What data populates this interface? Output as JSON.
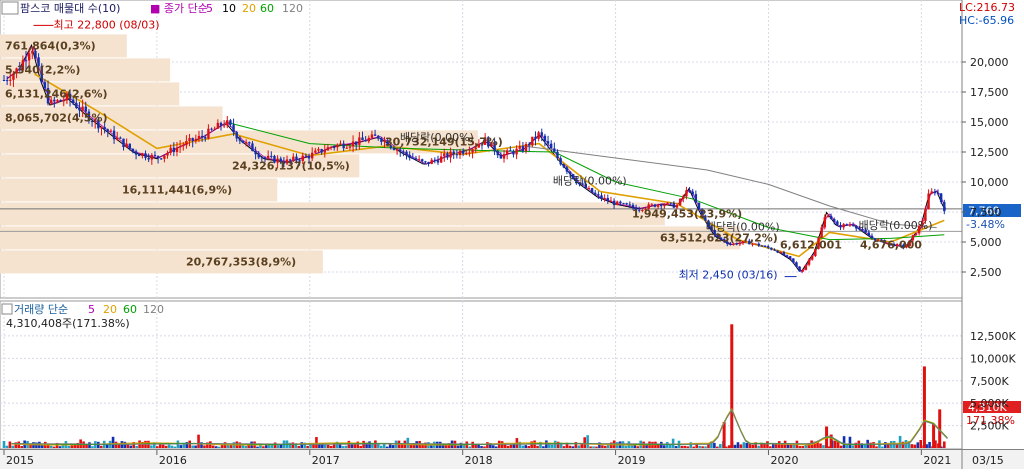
{
  "price_panel": {
    "title": "팜스코 매물대 수(10)",
    "ma_label": "종가 단순",
    "ma_periods": [
      "5",
      "10",
      "20",
      "60",
      "120"
    ],
    "ma_colors": [
      "#b000b0",
      "#000000",
      "#e0a000",
      "#00a000",
      "#808080"
    ],
    "high_marker": "최고 22,800 (08/03)",
    "low_marker": "최저 2,450 (03/16)",
    "lc": "LC:216.73",
    "hc": "HC:-65.96",
    "current_price": "7,760",
    "current_change": "-3.48%",
    "dividend_label": "배당락(0.00%)",
    "y_ticks": [
      "20,000",
      "17,500",
      "15,000",
      "12,500",
      "10,000",
      "7,500",
      "5,000",
      "2,500"
    ]
  },
  "volume_panel": {
    "title": "거래량 단순",
    "ma_periods": [
      "5",
      "20",
      "60",
      "120"
    ],
    "ma_colors": [
      "#b000b0",
      "#e0a000",
      "#00a000",
      "#808080"
    ],
    "summary": "4,310,408주(171.38%)",
    "current_volume": "4,310K",
    "current_ratio": "171.38%",
    "y_ticks": [
      "12,500K",
      "10,000K",
      "7,500K",
      "5,000K",
      "2,500K"
    ]
  },
  "x_axis": {
    "labels": [
      "2015",
      "2016",
      "2017",
      "2018",
      "2019",
      "2020",
      "2021"
    ],
    "last_date": "03/15"
  },
  "chart_data": {
    "type": "candlestick",
    "x_range": [
      "2015-01",
      "2021-03"
    ],
    "price_ylim": [
      1000,
      23500
    ],
    "volume_ylim": [
      0,
      14500
    ],
    "volume_series_unit": "K",
    "volume_profile": [
      {
        "label": "761,864(0,3%)",
        "price": 21300,
        "value": 761864,
        "pct": 0.3
      },
      {
        "label": "5,340(2,2%)",
        "price": 19300,
        "value": 5340,
        "pct": 2.2
      },
      {
        "label": "6,131,246(2,6%)",
        "price": 17300,
        "value": 6131246,
        "pct": 2.6
      },
      {
        "label": "8,065,702(4,5%)",
        "price": 15300,
        "value": 8065702,
        "pct": 4.5
      },
      {
        "label": "30,732,149(15,7%)",
        "price": 13300,
        "value": 30732149,
        "pct": 15.7
      },
      {
        "label": "24,326,137(10,5%)",
        "price": 11300,
        "value": 24326137,
        "pct": 10.5
      },
      {
        "label": "16,111,441(6,9%)",
        "price": 9300,
        "value": 16111441,
        "pct": 6.9
      },
      {
        "label": "1,949,453(23,9%)",
        "price": 7300,
        "value": 1949453,
        "pct": 23.9
      },
      {
        "label": "63,512,623(27,2%)",
        "price": 5300,
        "value": 63512623,
        "pct": 27.2
      },
      {
        "label": "20,767,353(8,9%)",
        "price": 3300,
        "value": 20767353,
        "pct": 8.9
      }
    ],
    "extra_profile_labels": [
      "6,612,001",
      "4,676,000"
    ],
    "high": {
      "date": "2015-08-03",
      "value": 22800
    },
    "low": {
      "date": "2020-03-16",
      "value": 2450
    },
    "last_close": 7760,
    "last_volume_k": 4310,
    "dividend_markers": [
      {
        "date": "2017-12",
        "pct": "0.00%"
      },
      {
        "date": "2018-12",
        "pct": "0.00%"
      },
      {
        "date": "2019-12",
        "pct": "0.00%"
      },
      {
        "date": "2020-12",
        "pct": "0.00%"
      }
    ],
    "price_path": [
      {
        "t": 2015.0,
        "v": 18500
      },
      {
        "t": 2015.1,
        "v": 19500
      },
      {
        "t": 2015.18,
        "v": 21500
      },
      {
        "t": 2015.24,
        "v": 18500
      },
      {
        "t": 2015.3,
        "v": 16500
      },
      {
        "t": 2015.42,
        "v": 17000
      },
      {
        "t": 2015.55,
        "v": 15500
      },
      {
        "t": 2015.7,
        "v": 14000
      },
      {
        "t": 2015.85,
        "v": 12500
      },
      {
        "t": 2016.0,
        "v": 12000
      },
      {
        "t": 2016.15,
        "v": 13000
      },
      {
        "t": 2016.3,
        "v": 13800
      },
      {
        "t": 2016.45,
        "v": 15000
      },
      {
        "t": 2016.55,
        "v": 13500
      },
      {
        "t": 2016.7,
        "v": 12000
      },
      {
        "t": 2016.85,
        "v": 11700
      },
      {
        "t": 2017.0,
        "v": 12200
      },
      {
        "t": 2017.15,
        "v": 13000
      },
      {
        "t": 2017.3,
        "v": 13300
      },
      {
        "t": 2017.45,
        "v": 13800
      },
      {
        "t": 2017.6,
        "v": 12500
      },
      {
        "t": 2017.75,
        "v": 11500
      },
      {
        "t": 2017.9,
        "v": 12200
      },
      {
        "t": 2018.05,
        "v": 12800
      },
      {
        "t": 2018.15,
        "v": 13500
      },
      {
        "t": 2018.25,
        "v": 12200
      },
      {
        "t": 2018.4,
        "v": 12800
      },
      {
        "t": 2018.5,
        "v": 14000
      },
      {
        "t": 2018.62,
        "v": 12000
      },
      {
        "t": 2018.75,
        "v": 10000
      },
      {
        "t": 2018.88,
        "v": 8800
      },
      {
        "t": 2019.0,
        "v": 8200
      },
      {
        "t": 2019.15,
        "v": 7800
      },
      {
        "t": 2019.3,
        "v": 8200
      },
      {
        "t": 2019.4,
        "v": 8000
      },
      {
        "t": 2019.48,
        "v": 9500
      },
      {
        "t": 2019.55,
        "v": 7500
      },
      {
        "t": 2019.65,
        "v": 5500
      },
      {
        "t": 2019.75,
        "v": 4800
      },
      {
        "t": 2019.85,
        "v": 5000
      },
      {
        "t": 2019.95,
        "v": 4700
      },
      {
        "t": 2020.05,
        "v": 4300
      },
      {
        "t": 2020.15,
        "v": 3500
      },
      {
        "t": 2020.21,
        "v": 2450
      },
      {
        "t": 2020.3,
        "v": 4200
      },
      {
        "t": 2020.38,
        "v": 7500
      },
      {
        "t": 2020.45,
        "v": 6300
      },
      {
        "t": 2020.55,
        "v": 6500
      },
      {
        "t": 2020.68,
        "v": 5300
      },
      {
        "t": 2020.8,
        "v": 4800
      },
      {
        "t": 2020.9,
        "v": 4600
      },
      {
        "t": 2021.0,
        "v": 6500
      },
      {
        "t": 2021.05,
        "v": 9000
      },
      {
        "t": 2021.1,
        "v": 9300
      },
      {
        "t": 2021.15,
        "v": 7760
      }
    ],
    "volume_spikes": [
      {
        "t": 2019.76,
        "v": 13800
      },
      {
        "t": 2019.71,
        "v": 2900
      },
      {
        "t": 2020.38,
        "v": 2400
      },
      {
        "t": 2020.41,
        "v": 1500
      },
      {
        "t": 2021.02,
        "v": 9100
      },
      {
        "t": 2021.12,
        "v": 4310
      },
      {
        "t": 2021.08,
        "v": 2700
      }
    ],
    "price_ma": [
      {
        "name": "20",
        "color": "#e0a000",
        "points": [
          {
            "t": 2015.2,
            "v": 19000
          },
          {
            "t": 2015.6,
            "v": 16000
          },
          {
            "t": 2016.0,
            "v": 12800
          },
          {
            "t": 2016.5,
            "v": 14000
          },
          {
            "t": 2017.0,
            "v": 12200
          },
          {
            "t": 2017.5,
            "v": 13000
          },
          {
            "t": 2018.0,
            "v": 12300
          },
          {
            "t": 2018.5,
            "v": 13200
          },
          {
            "t": 2018.9,
            "v": 9200
          },
          {
            "t": 2019.4,
            "v": 8200
          },
          {
            "t": 2019.8,
            "v": 5200
          },
          {
            "t": 2020.2,
            "v": 3800
          },
          {
            "t": 2020.4,
            "v": 5800
          },
          {
            "t": 2020.8,
            "v": 5000
          },
          {
            "t": 2021.15,
            "v": 6800
          }
        ]
      },
      {
        "name": "60",
        "color": "#00a000",
        "points": [
          {
            "t": 2016.45,
            "v": 15000
          },
          {
            "t": 2017.0,
            "v": 13200
          },
          {
            "t": 2017.6,
            "v": 12800
          },
          {
            "t": 2018.2,
            "v": 12600
          },
          {
            "t": 2018.6,
            "v": 12500
          },
          {
            "t": 2019.0,
            "v": 10000
          },
          {
            "t": 2019.5,
            "v": 8600
          },
          {
            "t": 2020.0,
            "v": 6200
          },
          {
            "t": 2020.4,
            "v": 5200
          },
          {
            "t": 2020.8,
            "v": 5300
          },
          {
            "t": 2021.15,
            "v": 5600
          }
        ]
      },
      {
        "name": "120",
        "color": "#808080",
        "points": [
          {
            "t": 2018.4,
            "v": 13000
          },
          {
            "t": 2019.0,
            "v": 12000
          },
          {
            "t": 2019.6,
            "v": 11000
          },
          {
            "t": 2020.0,
            "v": 9800
          },
          {
            "t": 2020.4,
            "v": 8000
          },
          {
            "t": 2020.8,
            "v": 6500
          },
          {
            "t": 2021.1,
            "v": 6200
          }
        ]
      }
    ]
  }
}
